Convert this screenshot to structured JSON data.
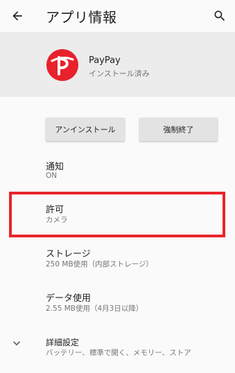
{
  "header": {
    "title": "アプリ情報",
    "back_icon": "arrow-back-icon",
    "search_icon": "search-icon"
  },
  "app": {
    "name": "PayPay",
    "status": "インストール済み",
    "logo_icon": "paypay-logo-icon",
    "brand_color": "#e8212b"
  },
  "actions": {
    "uninstall_label": "アンインストール",
    "force_stop_label": "強制終了"
  },
  "settings": {
    "notifications": {
      "title": "通知",
      "value": "ON"
    },
    "permissions": {
      "title": "許可",
      "value": "カメラ"
    },
    "storage": {
      "title": "ストレージ",
      "value": "250 MB使用（内部ストレージ）"
    },
    "data_usage": {
      "title": "データ使用",
      "value": "2.55 MB使用（4月3日以降）"
    },
    "advanced": {
      "title": "詳細設定",
      "value": "バッテリー、標準で開く、メモリー、ストア",
      "icon": "chevron-down-icon"
    }
  },
  "highlight_color": "#e8242b"
}
